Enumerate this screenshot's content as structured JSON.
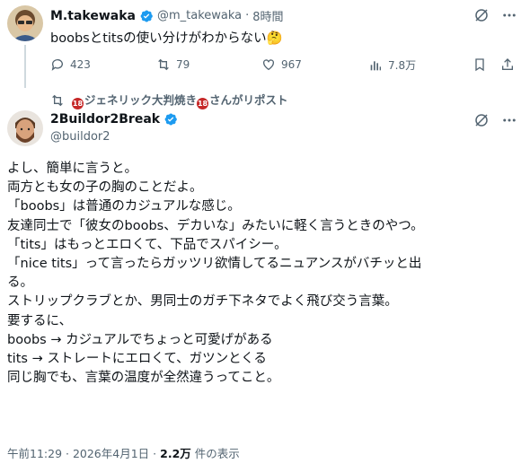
{
  "reply_tweet": {
    "display_name": "M.takewaka",
    "handle": "@m_takewaka",
    "separator": "·",
    "time_ago": "8時間",
    "text": "boobsとtitsの使い分けがわからない",
    "emoji": "🤔",
    "metrics": {
      "replies": "423",
      "retweets": "79",
      "likes": "967",
      "views": "7.8万"
    }
  },
  "repost_bar": {
    "text": "ジェネリック大判焼き",
    "badge": "18",
    "text2": "さんがリポスト"
  },
  "main_tweet": {
    "display_name": "2Buildor2Break",
    "handle": "@buildor2",
    "body": [
      "よし、簡単に言うと。",
      "両方とも女の子の胸のことだよ。",
      "「boobs」は普通のカジュアルな感じ。",
      "友達同士で「彼女のboobs、デカいな」みたいに軽く言うときのやつ。",
      "「tits」はもっとエロくて、下品でスパイシー。",
      "「nice tits」って言ったらガッツリ欲情してるニュアンスがバチッと出",
      "る。",
      "ストリップクラブとか、男同士のガチ下ネタでよく飛び交う言葉。",
      "要するに、",
      "boobs → カジュアルでちょっと可愛げがある",
      "tits → ストレートにエロくて、ガツンとくる",
      "同じ胸でも、言葉の温度が全然違うってこと。"
    ],
    "timestamp": "午前11:29 · 2026年4月1日",
    "dot": "·",
    "views_count": "2.2万",
    "views_label": "件の表示"
  },
  "colors": {
    "verified": "#1d9bf0",
    "muted": "#536471",
    "text": "#0f1419",
    "thread_line": "#cfd9de"
  },
  "icons": [
    "verified-badge-icon",
    "grok-icon",
    "more-icon",
    "reply-icon",
    "retweet-icon",
    "like-icon",
    "views-icon",
    "bookmark-icon",
    "share-icon",
    "repost-icon"
  ]
}
